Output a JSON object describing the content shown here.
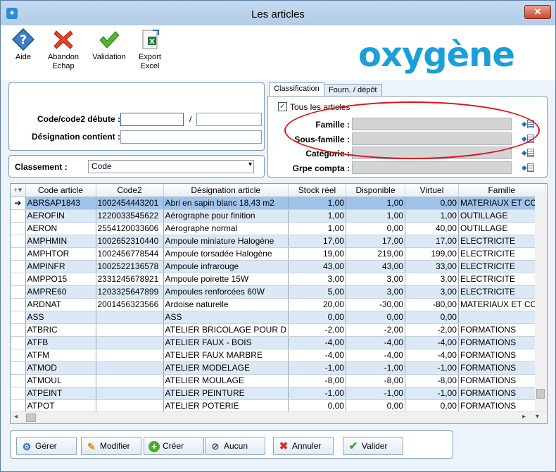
{
  "window": {
    "title": "Les articles"
  },
  "toolbar": {
    "aide": "Aide",
    "abandon": "Abandon\nEchap",
    "abandon_l1": "Abandon",
    "abandon_l2": "Echap",
    "validation": "Validation",
    "export_l1": "Export",
    "export_l2": "Excel"
  },
  "logo": "oxygène",
  "filters": {
    "code_label": "Code/code2 débute :",
    "code_sep": "/",
    "designation_label": "Désignation contient :",
    "classement_label": "Classement :",
    "classement_value": "Code"
  },
  "tabs": {
    "classification": "Classification",
    "fourn": "Fourn. / dépôt"
  },
  "classification": {
    "tous_label": "Tous les articles",
    "famille": "Famille :",
    "sous_famille": "Sous-famille :",
    "categorie": "Catégorie :",
    "grpe": "Grpe compta :"
  },
  "grid": {
    "columns": [
      "Code article",
      "Code2",
      "Désignation article",
      "Stock réel",
      "Disponible",
      "Virtuel",
      "Famille"
    ],
    "rows": [
      [
        "ABRSAP1843",
        "1002454443201",
        "Abri en sapin blanc 18,43 m2",
        "1,00",
        "1,00",
        "0,00",
        "MATERIAUX ET CON"
      ],
      [
        "AEROFIN",
        "1220033545622",
        "Aérographe pour finition",
        "1,00",
        "1,00",
        "1,00",
        "OUTILLAGE"
      ],
      [
        "AERON",
        "2554120033606",
        "Aérographe normal",
        "1,00",
        "0,00",
        "40,00",
        "OUTILLAGE"
      ],
      [
        "AMPHMIN",
        "1002652310440",
        "Ampoule miniature Halogène",
        "17,00",
        "17,00",
        "17,00",
        "ELECTRICITE"
      ],
      [
        "AMPHTOR",
        "1002456778544",
        "Ampoule torsadée Halogène",
        "19,00",
        "219,00",
        "199,00",
        "ELECTRICITE"
      ],
      [
        "AMPINFR",
        "1002522136578",
        "Ampoule infrarouge",
        "43,00",
        "43,00",
        "33,00",
        "ELECTRICITE"
      ],
      [
        "AMPPO15",
        "2331245678921",
        "Ampoule poirette 15W",
        "3,00",
        "3,00",
        "3,00",
        "ELECTRICITE"
      ],
      [
        "AMPRE60",
        "1203325647899",
        "Ampoules renforcées 60W",
        "5,00",
        "3,00",
        "3,00",
        "ELECTRICITE"
      ],
      [
        "ARDNAT",
        "2001456323566",
        "Ardoise naturelle",
        "20,00",
        "-30,00",
        "-80,00",
        "MATERIAUX ET CON"
      ],
      [
        "ASS",
        "",
        "ASS",
        "0,00",
        "0,00",
        "0,00",
        ""
      ],
      [
        "ATBRIC",
        "",
        "ATELIER BRICOLAGE POUR D",
        "-2,00",
        "-2,00",
        "-2,00",
        "FORMATIONS"
      ],
      [
        "ATFB",
        "",
        "ATELIER FAUX - BOIS",
        "-4,00",
        "-4,00",
        "-4,00",
        "FORMATIONS"
      ],
      [
        "ATFM",
        "",
        "ATELIER FAUX MARBRE",
        "-4,00",
        "-4,00",
        "-4,00",
        "FORMATIONS"
      ],
      [
        "ATMOD",
        "",
        "ATELIER MODELAGE",
        "-1,00",
        "-1,00",
        "-1,00",
        "FORMATIONS"
      ],
      [
        "ATMOUL",
        "",
        "ATELIER MOULAGE",
        "-8,00",
        "-8,00",
        "-8,00",
        "FORMATIONS"
      ],
      [
        "ATPEINT",
        "",
        "ATELIER PEINTURE",
        "-1,00",
        "-1,00",
        "-1,00",
        "FORMATIONS"
      ],
      [
        "ATPOT",
        "",
        "ATELIER POTERIE",
        "0,00",
        "0,00",
        "0,00",
        "FORMATIONS"
      ]
    ]
  },
  "actions": {
    "gerer": "Gérer",
    "modifier": "Modifier",
    "creer": "Créer",
    "aucun": "Aucun",
    "annuler": "Annuler",
    "valider": "Valider"
  },
  "colors": {
    "accent": "#1a9fd8",
    "selection": "#9fc3ea",
    "alt_row": "#dbe9f6",
    "highlight_oval": "#e0101a"
  }
}
